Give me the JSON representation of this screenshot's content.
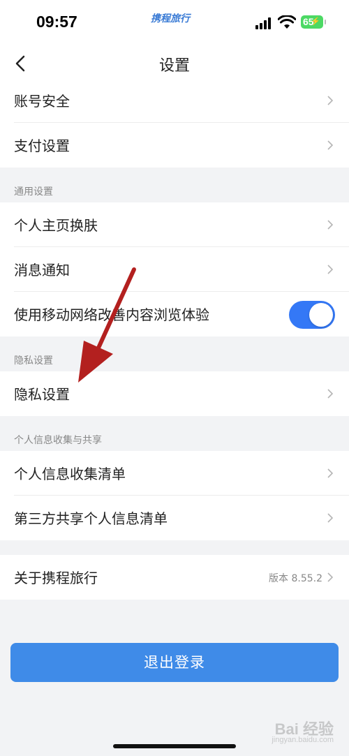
{
  "status_bar": {
    "time": "09:57",
    "brand": "携程旅行",
    "battery": "65"
  },
  "nav": {
    "title": "设置"
  },
  "rows": {
    "account_security": "账号安全",
    "payment_settings": "支付设置",
    "profile_skin": "个人主页换肤",
    "notifications": "消息通知",
    "mobile_network": "使用移动网络改善内容浏览体验",
    "privacy_settings": "隐私设置",
    "personal_info_list": "个人信息收集清单",
    "third_party_list": "第三方共享个人信息清单",
    "about": "关于携程旅行"
  },
  "sections": {
    "general": "通用设置",
    "privacy": "隐私设置",
    "personal_info": "个人信息收集与共享"
  },
  "toggle": {
    "mobile_network_enabled": true
  },
  "about": {
    "version": "版本 8.55.2"
  },
  "logout": {
    "label": "退出登录"
  },
  "watermark": {
    "text": "Bai 经验",
    "sub": "jingyan.baidu.com"
  },
  "colors": {
    "accent": "#3478f6",
    "button": "#3f8be8",
    "arrow": "#b3201f",
    "background": "#f2f3f5"
  }
}
